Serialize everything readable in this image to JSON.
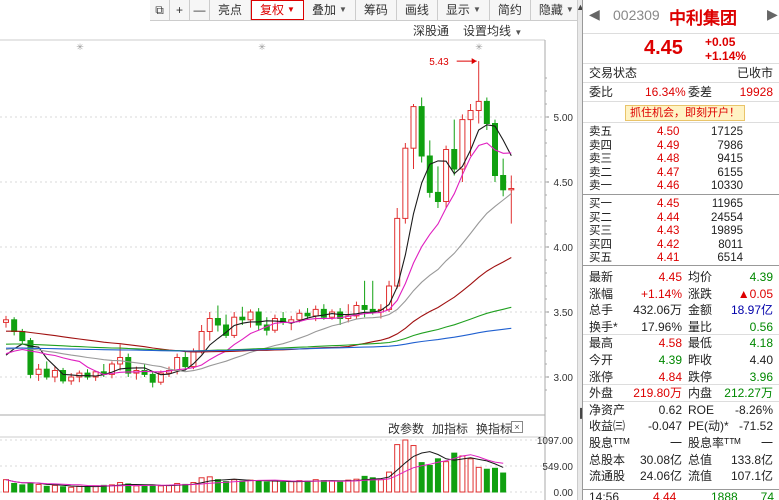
{
  "toolbar": {
    "items": [
      {
        "label": "",
        "icon": "restore-icon"
      },
      {
        "label": "+",
        "icon": "zoom-in-icon"
      },
      {
        "label": "—",
        "icon": "zoom-out-icon"
      },
      {
        "label": "亮点"
      },
      {
        "label": "复权",
        "dropdown": true,
        "active": true
      },
      {
        "label": "叠加",
        "dropdown": true
      },
      {
        "label": "筹码"
      },
      {
        "label": "画线"
      },
      {
        "label": "显示",
        "dropdown": true
      },
      {
        "label": "简约"
      },
      {
        "label": "隐藏",
        "dropdown": true
      },
      {
        "label": "",
        "icon": "minimize-icon"
      }
    ]
  },
  "subbar": {
    "index_label": "深股通",
    "ma_setting_label": "设置均线"
  },
  "indicator_bar": {
    "edit_params": "改参数",
    "add_indicator": "加指标",
    "switch_indicator": "换指标",
    "close": "×"
  },
  "chart_data": {
    "type": "candlestick",
    "y_ticks": [
      "5.00",
      "4.50",
      "4.00",
      "3.50",
      "3.00"
    ],
    "high_marker": "5.43",
    "volume_ticks": [
      "1097.00",
      "549.00",
      "0.00"
    ],
    "colors": {
      "up": "#e03030",
      "down": "#10a010",
      "ma5": "#1a1a1a",
      "ma10": "#e020c0",
      "ma20": "#999999",
      "ma30": "#a01010",
      "ma60": "#20a020",
      "ma120": "#2060d0"
    },
    "candles": [
      {
        "o": 3.42,
        "h": 3.47,
        "l": 3.38,
        "c": 3.44
      },
      {
        "o": 3.44,
        "h": 3.46,
        "l": 3.32,
        "c": 3.35
      },
      {
        "o": 3.35,
        "h": 3.37,
        "l": 3.25,
        "c": 3.28
      },
      {
        "o": 3.28,
        "h": 3.3,
        "l": 2.99,
        "c": 3.02
      },
      {
        "o": 3.02,
        "h": 3.1,
        "l": 2.97,
        "c": 3.06
      },
      {
        "o": 3.06,
        "h": 3.12,
        "l": 2.98,
        "c": 3.0
      },
      {
        "o": 3.0,
        "h": 3.08,
        "l": 2.96,
        "c": 3.05
      },
      {
        "o": 3.05,
        "h": 3.07,
        "l": 2.95,
        "c": 2.97
      },
      {
        "o": 2.97,
        "h": 3.03,
        "l": 2.94,
        "c": 3.0
      },
      {
        "o": 3.0,
        "h": 3.05,
        "l": 2.96,
        "c": 3.03
      },
      {
        "o": 3.03,
        "h": 3.06,
        "l": 2.98,
        "c": 3.0
      },
      {
        "o": 3.0,
        "h": 3.05,
        "l": 2.97,
        "c": 3.04
      },
      {
        "o": 3.04,
        "h": 3.1,
        "l": 3.0,
        "c": 3.02
      },
      {
        "o": 3.02,
        "h": 3.12,
        "l": 2.99,
        "c": 3.1
      },
      {
        "o": 3.1,
        "h": 3.25,
        "l": 3.05,
        "c": 3.15
      },
      {
        "o": 3.15,
        "h": 3.18,
        "l": 3.0,
        "c": 3.03
      },
      {
        "o": 3.03,
        "h": 3.08,
        "l": 2.98,
        "c": 3.05
      },
      {
        "o": 3.05,
        "h": 3.1,
        "l": 3.0,
        "c": 3.02
      },
      {
        "o": 3.02,
        "h": 3.04,
        "l": 2.92,
        "c": 2.96
      },
      {
        "o": 2.96,
        "h": 3.05,
        "l": 2.94,
        "c": 3.03
      },
      {
        "o": 3.03,
        "h": 3.08,
        "l": 3.0,
        "c": 3.05
      },
      {
        "o": 3.05,
        "h": 3.18,
        "l": 3.02,
        "c": 3.15
      },
      {
        "o": 3.15,
        "h": 3.2,
        "l": 3.05,
        "c": 3.08
      },
      {
        "o": 3.08,
        "h": 3.22,
        "l": 3.06,
        "c": 3.2
      },
      {
        "o": 3.2,
        "h": 3.4,
        "l": 3.18,
        "c": 3.35
      },
      {
        "o": 3.35,
        "h": 3.5,
        "l": 3.28,
        "c": 3.45
      },
      {
        "o": 3.45,
        "h": 3.55,
        "l": 3.35,
        "c": 3.4
      },
      {
        "o": 3.4,
        "h": 3.48,
        "l": 3.3,
        "c": 3.32
      },
      {
        "o": 3.32,
        "h": 3.5,
        "l": 3.3,
        "c": 3.46
      },
      {
        "o": 3.46,
        "h": 3.54,
        "l": 3.4,
        "c": 3.44
      },
      {
        "o": 3.44,
        "h": 3.52,
        "l": 3.38,
        "c": 3.5
      },
      {
        "o": 3.5,
        "h": 3.53,
        "l": 3.36,
        "c": 3.4
      },
      {
        "o": 3.4,
        "h": 3.46,
        "l": 3.32,
        "c": 3.36
      },
      {
        "o": 3.36,
        "h": 3.48,
        "l": 3.34,
        "c": 3.45
      },
      {
        "o": 3.45,
        "h": 3.5,
        "l": 3.4,
        "c": 3.42
      },
      {
        "o": 3.42,
        "h": 3.47,
        "l": 3.36,
        "c": 3.44
      },
      {
        "o": 3.44,
        "h": 3.52,
        "l": 3.42,
        "c": 3.49
      },
      {
        "o": 3.49,
        "h": 3.53,
        "l": 3.44,
        "c": 3.47
      },
      {
        "o": 3.47,
        "h": 3.55,
        "l": 3.43,
        "c": 3.52
      },
      {
        "o": 3.52,
        "h": 3.56,
        "l": 3.44,
        "c": 3.46
      },
      {
        "o": 3.46,
        "h": 3.52,
        "l": 3.44,
        "c": 3.5
      },
      {
        "o": 3.5,
        "h": 3.53,
        "l": 3.4,
        "c": 3.45
      },
      {
        "o": 3.45,
        "h": 3.56,
        "l": 3.42,
        "c": 3.47
      },
      {
        "o": 3.47,
        "h": 3.58,
        "l": 3.45,
        "c": 3.55
      },
      {
        "o": 3.55,
        "h": 3.74,
        "l": 3.46,
        "c": 3.52
      },
      {
        "o": 3.52,
        "h": 3.74,
        "l": 3.48,
        "c": 3.5
      },
      {
        "o": 3.5,
        "h": 3.56,
        "l": 3.45,
        "c": 3.52
      },
      {
        "o": 3.52,
        "h": 3.74,
        "l": 3.5,
        "c": 3.7
      },
      {
        "o": 3.7,
        "h": 4.3,
        "l": 3.68,
        "c": 4.22
      },
      {
        "o": 4.22,
        "h": 4.8,
        "l": 4.18,
        "c": 4.76
      },
      {
        "o": 4.76,
        "h": 5.1,
        "l": 4.6,
        "c": 5.08
      },
      {
        "o": 5.08,
        "h": 5.15,
        "l": 4.65,
        "c": 4.7
      },
      {
        "o": 4.7,
        "h": 4.82,
        "l": 4.38,
        "c": 4.42
      },
      {
        "o": 4.42,
        "h": 4.62,
        "l": 4.3,
        "c": 4.35
      },
      {
        "o": 4.35,
        "h": 4.78,
        "l": 4.3,
        "c": 4.75
      },
      {
        "o": 4.75,
        "h": 4.98,
        "l": 4.55,
        "c": 4.6
      },
      {
        "o": 4.6,
        "h": 5.02,
        "l": 4.5,
        "c": 4.98
      },
      {
        "o": 4.98,
        "h": 5.1,
        "l": 4.7,
        "c": 5.05
      },
      {
        "o": 5.05,
        "h": 5.43,
        "l": 4.95,
        "c": 5.12
      },
      {
        "o": 5.12,
        "h": 5.15,
        "l": 4.9,
        "c": 4.95
      },
      {
        "o": 4.95,
        "h": 4.98,
        "l": 4.5,
        "c": 4.55
      },
      {
        "o": 4.55,
        "h": 4.68,
        "l": 4.39,
        "c": 4.44
      },
      {
        "o": 4.44,
        "h": 4.55,
        "l": 4.18,
        "c": 4.45
      }
    ],
    "volumes": [
      260,
      180,
      150,
      190,
      160,
      120,
      140,
      110,
      100,
      120,
      110,
      130,
      140,
      150,
      200,
      170,
      130,
      120,
      150,
      130,
      140,
      180,
      160,
      200,
      300,
      320,
      260,
      220,
      260,
      230,
      250,
      240,
      210,
      230,
      200,
      220,
      240,
      230,
      260,
      240,
      230,
      210,
      250,
      270,
      330,
      300,
      260,
      420,
      1000,
      1097,
      980,
      620,
      560,
      700,
      640,
      820,
      760,
      700,
      520,
      480,
      500,
      400
    ]
  },
  "quote": {
    "nav_prev": "◀",
    "nav_next": "▶",
    "code": "002309",
    "name": "中利集团",
    "price": "4.45",
    "change": "+0.05",
    "change_pct": "+1.14%",
    "status_label": "交易状态",
    "status_value": "已收市",
    "weibi_label": "委比",
    "weibi_value": "16.34%",
    "weicha_label": "委差",
    "weicha_value": "19928",
    "promo": "抓住机会，即刻开户！",
    "sells": [
      {
        "label": "卖五",
        "price": "4.50",
        "vol": "17125"
      },
      {
        "label": "卖四",
        "price": "4.49",
        "vol": "7986"
      },
      {
        "label": "卖三",
        "price": "4.48",
        "vol": "9415"
      },
      {
        "label": "卖二",
        "price": "4.47",
        "vol": "6155"
      },
      {
        "label": "卖一",
        "price": "4.46",
        "vol": "10330"
      }
    ],
    "buys": [
      {
        "label": "买一",
        "price": "4.45",
        "vol": "11965"
      },
      {
        "label": "买二",
        "price": "4.44",
        "vol": "24554"
      },
      {
        "label": "买三",
        "price": "4.43",
        "vol": "19895"
      },
      {
        "label": "买四",
        "price": "4.42",
        "vol": "8011"
      },
      {
        "label": "买五",
        "price": "4.41",
        "vol": "6514"
      }
    ],
    "stats": [
      {
        "k1": "最新",
        "v1": "4.45",
        "c1": "red",
        "k2": "均价",
        "v2": "4.39",
        "c2": "green"
      },
      {
        "k1": "涨幅",
        "v1": "+1.14%",
        "c1": "red",
        "k2": "涨跌",
        "v2": "▲0.05",
        "c2": "red"
      },
      {
        "k1": "总手",
        "v1": "432.06万",
        "c1": "",
        "k2": "金额",
        "v2": "18.97亿",
        "c2": "blue"
      },
      {
        "k1": "换手*",
        "v1": "17.96%",
        "c1": "",
        "k2": "量比",
        "v2": "0.56",
        "c2": "green",
        "sep": true
      },
      {
        "k1": "最高",
        "v1": "4.58",
        "c1": "red",
        "k2": "最低",
        "v2": "4.18",
        "c2": "green"
      },
      {
        "k1": "今开",
        "v1": "4.39",
        "c1": "green",
        "k2": "昨收",
        "v2": "4.40",
        "c2": ""
      },
      {
        "k1": "涨停",
        "v1": "4.84",
        "c1": "red",
        "k2": "跌停",
        "v2": "3.96",
        "c2": "green",
        "sep": true
      },
      {
        "k1": "外盘",
        "v1": "219.80万",
        "c1": "red",
        "k2": "内盘",
        "v2": "212.27万",
        "c2": "green",
        "sep": true
      },
      {
        "k1": "净资产",
        "v1": "0.62",
        "c1": "",
        "k2": "ROE",
        "v2": "-8.26%",
        "c2": ""
      },
      {
        "k1": "收益㈢",
        "v1": "-0.047",
        "c1": "",
        "k2": "PE(动)*",
        "v2": "-71.52",
        "c2": ""
      },
      {
        "k1": "股息ᵀᵀᴹ",
        "v1": "一",
        "c1": "",
        "k2": "股息率ᵀᵀᴹ",
        "v2": "一",
        "c2": ""
      },
      {
        "k1": "总股本",
        "v1": "30.08亿",
        "c1": "",
        "k2": "总值",
        "v2": "133.8亿",
        "c2": ""
      },
      {
        "k1": "流通股",
        "v1": "24.06亿",
        "c1": "",
        "k2": "流值",
        "v2": "107.1亿",
        "c2": ""
      }
    ],
    "last_tick": {
      "time": "14:56",
      "price": "4.44",
      "vol": "1888",
      "num": "74"
    }
  }
}
